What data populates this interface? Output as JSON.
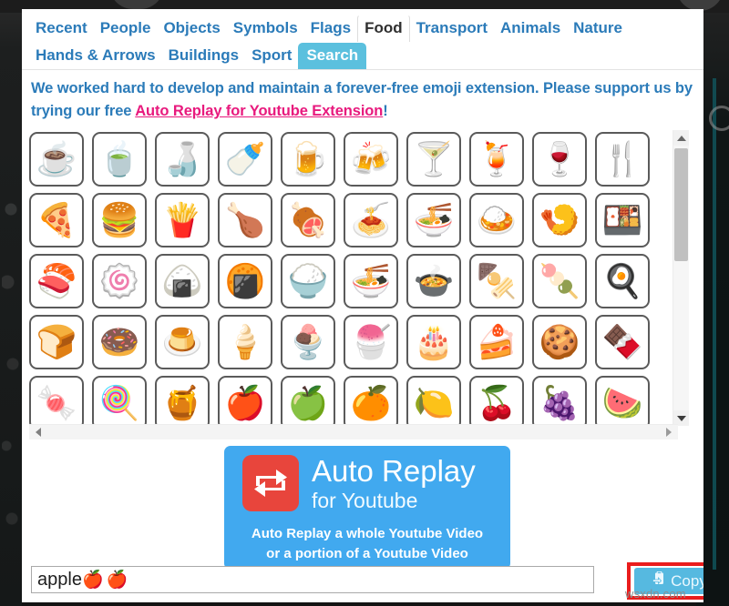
{
  "tabs": {
    "row1": [
      {
        "label": "Recent",
        "state": "normal"
      },
      {
        "label": "People",
        "state": "normal"
      },
      {
        "label": "Objects",
        "state": "normal"
      },
      {
        "label": "Symbols",
        "state": "normal"
      },
      {
        "label": "Flags",
        "state": "normal"
      },
      {
        "label": "Food",
        "state": "active"
      },
      {
        "label": "Transport",
        "state": "normal"
      },
      {
        "label": "Animals",
        "state": "normal"
      },
      {
        "label": "Nature",
        "state": "normal"
      }
    ],
    "row2": [
      {
        "label": "Hands & Arrows",
        "state": "normal"
      },
      {
        "label": "Buildings",
        "state": "normal"
      },
      {
        "label": "Sport",
        "state": "normal"
      },
      {
        "label": "Search",
        "state": "selected"
      }
    ]
  },
  "promo": {
    "text_before": "We worked hard to develop and maintain a forever-free emoji extension. Please support us by trying our free ",
    "link": "Auto Replay for Youtube Extension",
    "text_after": "!"
  },
  "emoji_grid": {
    "rows": [
      [
        {
          "char": "☕",
          "name": "hot-beverage"
        },
        {
          "char": "🍵",
          "name": "teacup-without-handle"
        },
        {
          "char": "🍶",
          "name": "sake"
        },
        {
          "char": "🍼",
          "name": "baby-bottle"
        },
        {
          "char": "🍺",
          "name": "beer-mug"
        },
        {
          "char": "🍻",
          "name": "clinking-beer-mugs"
        },
        {
          "char": "🍸",
          "name": "cocktail-glass"
        },
        {
          "char": "🍹",
          "name": "tropical-drink"
        },
        {
          "char": "🍷",
          "name": "wine-glass"
        },
        {
          "char": "🍴",
          "name": "fork-and-knife"
        }
      ],
      [
        {
          "char": "🍕",
          "name": "pizza"
        },
        {
          "char": "🍔",
          "name": "hamburger"
        },
        {
          "char": "🍟",
          "name": "french-fries"
        },
        {
          "char": "🍗",
          "name": "poultry-leg"
        },
        {
          "char": "🍖",
          "name": "meat-on-bone"
        },
        {
          "char": "🍝",
          "name": "spaghetti"
        },
        {
          "char": "🍜",
          "name": "steaming-bowl"
        },
        {
          "char": "🍛",
          "name": "curry-rice"
        },
        {
          "char": "🍤",
          "name": "fried-shrimp"
        },
        {
          "char": "🍱",
          "name": "bento-box"
        }
      ],
      [
        {
          "char": "🍣",
          "name": "sushi"
        },
        {
          "char": "🍥",
          "name": "fish-cake"
        },
        {
          "char": "🍙",
          "name": "rice-ball"
        },
        {
          "char": "🍘",
          "name": "rice-cracker"
        },
        {
          "char": "🍚",
          "name": "cooked-rice"
        },
        {
          "char": "🍜",
          "name": "ramen-noodles"
        },
        {
          "char": "🍲",
          "name": "pot-of-food"
        },
        {
          "char": "🍢",
          "name": "oden"
        },
        {
          "char": "🍡",
          "name": "dango"
        },
        {
          "char": "🍳",
          "name": "cooking-fried-egg"
        }
      ],
      [
        {
          "char": "🍞",
          "name": "bread"
        },
        {
          "char": "🍩",
          "name": "doughnut"
        },
        {
          "char": "🍮",
          "name": "custard"
        },
        {
          "char": "🍦",
          "name": "soft-ice-cream"
        },
        {
          "char": "🍨",
          "name": "ice-cream"
        },
        {
          "char": "🍧",
          "name": "shaved-ice"
        },
        {
          "char": "🎂",
          "name": "birthday-cake"
        },
        {
          "char": "🍰",
          "name": "shortcake"
        },
        {
          "char": "🍪",
          "name": "cookie"
        },
        {
          "char": "🍫",
          "name": "chocolate-bar"
        }
      ],
      [
        {
          "char": "🍬",
          "name": "candy"
        },
        {
          "char": "🍭",
          "name": "lollipop"
        },
        {
          "char": "🍯",
          "name": "honey-pot"
        },
        {
          "char": "🍎",
          "name": "red-apple"
        },
        {
          "char": "🍏",
          "name": "green-apple"
        },
        {
          "char": "🍊",
          "name": "tangerine"
        },
        {
          "char": "🍋",
          "name": "lemon"
        },
        {
          "char": "🍒",
          "name": "cherries"
        },
        {
          "char": "🍇",
          "name": "grapes"
        },
        {
          "char": "🍉",
          "name": "watermelon"
        }
      ]
    ]
  },
  "ad": {
    "title_line1": "Auto Replay",
    "title_line2": "for Youtube",
    "sub_line1": "Auto Replay a whole Youtube Video",
    "sub_line2": "or a portion of a Youtube Video",
    "logo_icon": "repeat-icon",
    "bg_color": "#41a9ef",
    "logo_color": "#e8453c"
  },
  "bottom": {
    "input_text": "apple",
    "input_emojis": "🍎🍎",
    "input_placeholder": "",
    "copy_label": "Copy",
    "copy_icon": "clipboard-icon",
    "highlight_color": "#ea1d1d"
  },
  "watermark": {
    "text": "wsxdn.com"
  }
}
